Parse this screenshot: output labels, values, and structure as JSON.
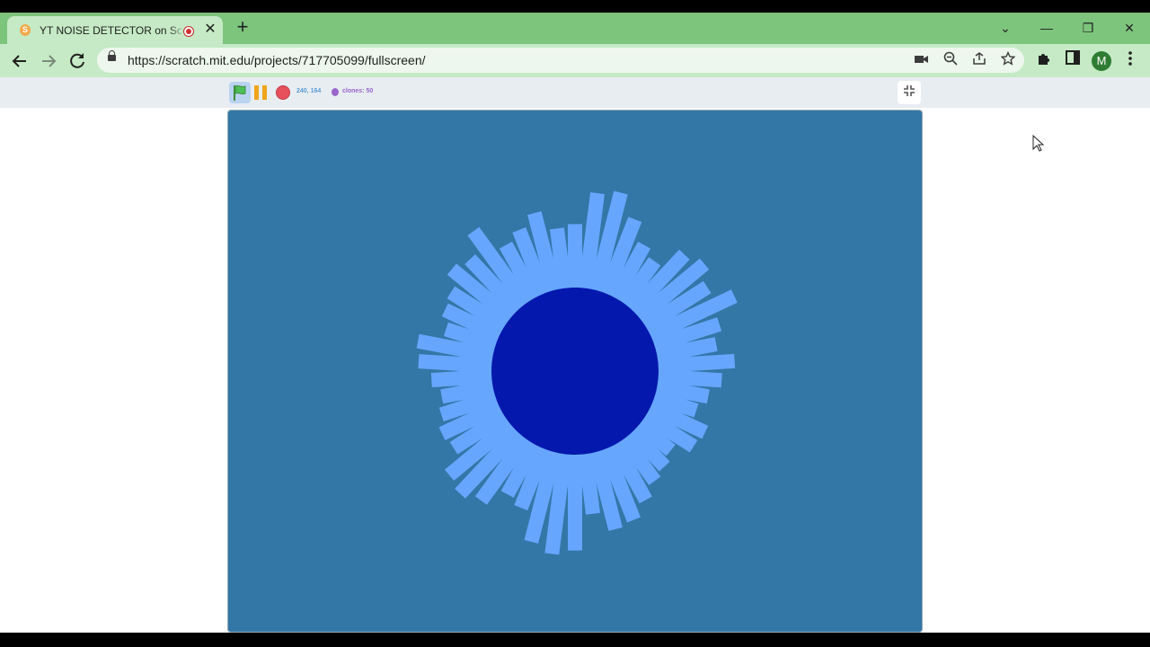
{
  "browser": {
    "tab": {
      "title": "YT NOISE DETECTOR on Scratch",
      "favicon_letter": "S",
      "close_glyph": "✕"
    },
    "new_tab_glyph": "+",
    "window_controls": {
      "dropdown": "⌄",
      "minimize": "—",
      "restore": "❐",
      "close": "✕"
    },
    "url": "https://scratch.mit.edu/projects/717705099/fullscreen/",
    "profile_initial": "M",
    "tab_bar_color": "#7dc47d",
    "active_tab_color": "#c5eac5"
  },
  "scratch": {
    "mouse_coords": "240, 164",
    "clones_label": "clones: 50",
    "stage_color": "#3277a6",
    "ring_color": "#66a6ff",
    "core_color": "#0418ad",
    "bar_count": 50,
    "bar_lengths": [
      0.62,
      0.82,
      0.85,
      0.72,
      0.6,
      0.55,
      0.7,
      0.75,
      0.68,
      0.8,
      0.65,
      0.6,
      0.7,
      0.62,
      0.55,
      0.5,
      0.6,
      0.58,
      0.48,
      0.52,
      0.55,
      0.62,
      0.7,
      0.72,
      0.6,
      0.82,
      0.85,
      0.8,
      0.62,
      0.58,
      0.7,
      0.75,
      0.72,
      0.6,
      0.62,
      0.58,
      0.55,
      0.6,
      0.68,
      0.7,
      0.55,
      0.6,
      0.62,
      0.7,
      0.66,
      0.78,
      0.6,
      0.65,
      0.72,
      0.6
    ]
  }
}
